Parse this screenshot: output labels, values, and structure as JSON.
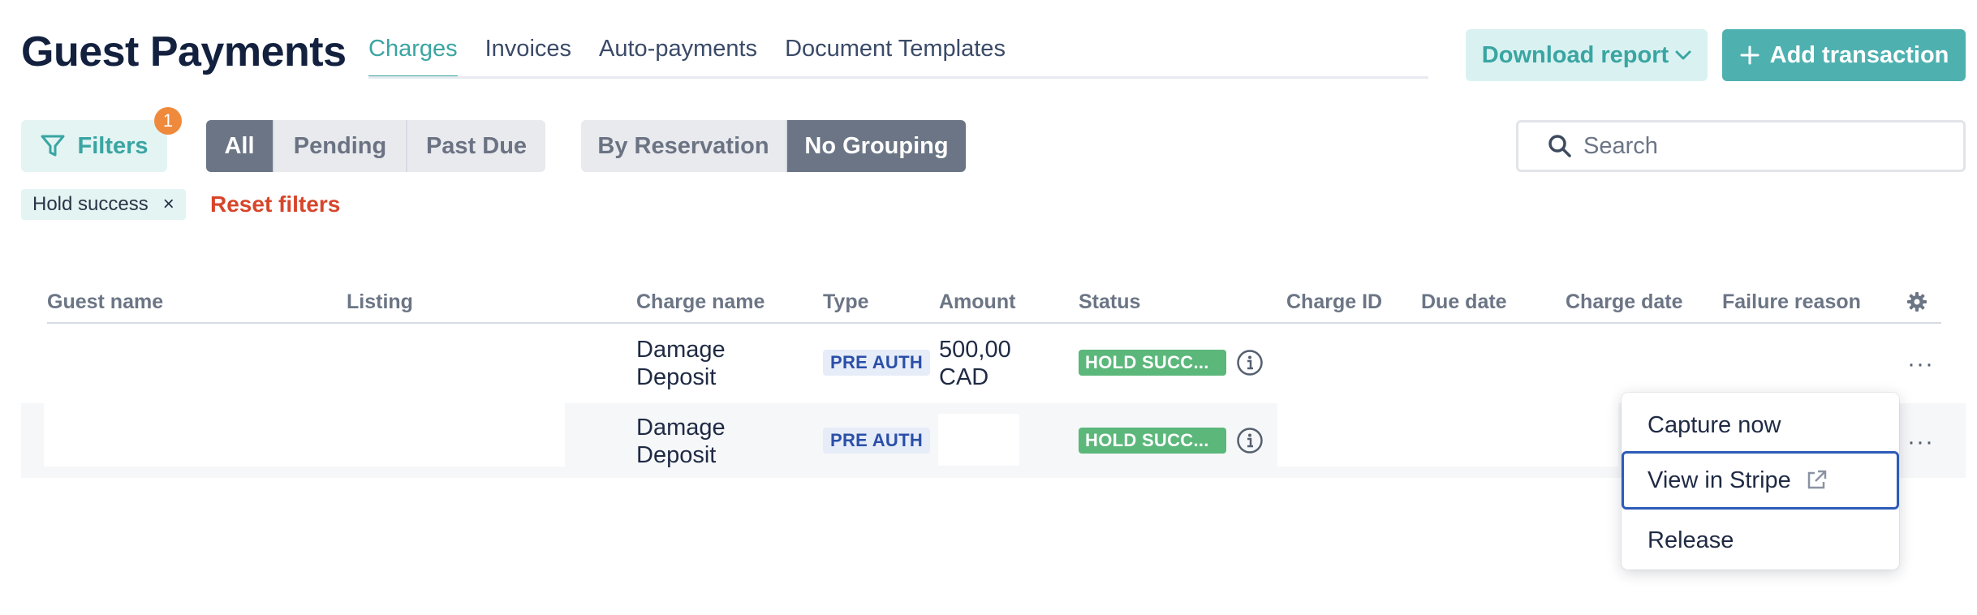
{
  "page": {
    "title": "Guest Payments",
    "tabs": [
      {
        "label": "Charges",
        "active": true
      },
      {
        "label": "Invoices",
        "active": false
      },
      {
        "label": "Auto-payments",
        "active": false
      },
      {
        "label": "Document Templates",
        "active": false
      }
    ]
  },
  "actions": {
    "download_label": "Download report",
    "add_label": "Add transaction"
  },
  "filters": {
    "button_label": "Filters",
    "badge_count": "1",
    "status_segments": [
      "All",
      "Pending",
      "Past Due"
    ],
    "status_selected": "All",
    "grouping_segments": [
      "By Reservation",
      "No Grouping"
    ],
    "grouping_selected": "No Grouping",
    "search_placeholder": "Search",
    "active_chip": "Hold success",
    "chip_close": "×",
    "reset_label": "Reset filters"
  },
  "table": {
    "columns": [
      "Guest name",
      "Listing",
      "Charge name",
      "Type",
      "Amount",
      "Status",
      "Charge ID",
      "Due date",
      "Charge date",
      "Failure reason"
    ],
    "rows": [
      {
        "charge_name_l1": "Damage",
        "charge_name_l2": "Deposit",
        "type": "PRE AUTH",
        "amount_l1": "500,00",
        "amount_l2": "CAD",
        "status": "HOLD SUCC...",
        "more": "···"
      },
      {
        "charge_name_l1": "Damage",
        "charge_name_l2": "Deposit",
        "type": "PRE AUTH",
        "status": "HOLD SUCC...",
        "more": "···"
      }
    ]
  },
  "row_menu": {
    "items": [
      "Capture now",
      "View in Stripe",
      "Release"
    ],
    "focused": "View in Stripe"
  },
  "colors": {
    "accent": "#3aa5a2",
    "primary_button": "#4eb1b0",
    "danger": "#d7452b",
    "badge": "#ef8a3c",
    "status_success": "#5bb77a",
    "type_pill_text": "#2b4fa8"
  },
  "icons": [
    "filter-icon",
    "search-icon",
    "plus-icon",
    "chevron-down-icon",
    "info-icon",
    "gear-icon",
    "external-link-icon",
    "close-icon",
    "more-icon"
  ]
}
